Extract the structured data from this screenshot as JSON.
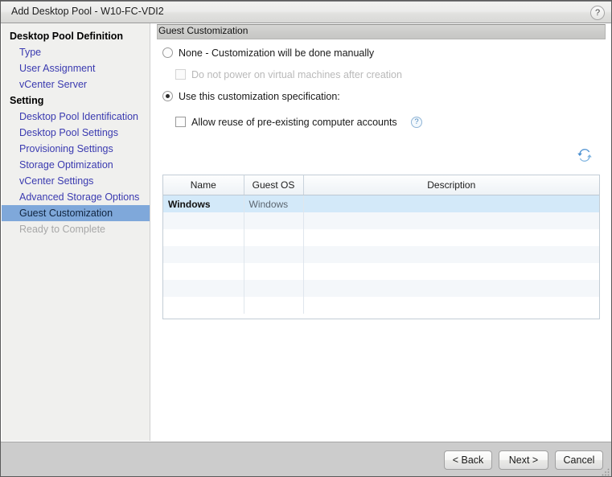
{
  "window": {
    "title": "Add Desktop Pool - W10-FC-VDI2",
    "help_icon": "question-mark-icon",
    "help_label": "?"
  },
  "sidebar": {
    "sections": [
      {
        "heading": "Desktop Pool Definition",
        "items": [
          {
            "label": "Type",
            "state": "link"
          },
          {
            "label": "User Assignment",
            "state": "link"
          },
          {
            "label": "vCenter Server",
            "state": "link"
          }
        ]
      },
      {
        "heading": "Setting",
        "items": [
          {
            "label": "Desktop Pool Identification",
            "state": "link"
          },
          {
            "label": "Desktop Pool Settings",
            "state": "link"
          },
          {
            "label": "Provisioning Settings",
            "state": "link"
          },
          {
            "label": "Storage Optimization",
            "state": "link"
          },
          {
            "label": "vCenter Settings",
            "state": "link"
          },
          {
            "label": "Advanced Storage Options",
            "state": "link"
          },
          {
            "label": "Guest Customization",
            "state": "selected"
          },
          {
            "label": "Ready to Complete",
            "state": "disabled"
          }
        ]
      }
    ]
  },
  "main": {
    "panel_title": "Guest Customization",
    "options": {
      "none_radio": {
        "label": "None - Customization will be done manually",
        "checked": false
      },
      "no_power_on_checkbox": {
        "label": "Do not power on virtual machines after creation",
        "checked": false,
        "enabled": false
      },
      "use_spec_radio": {
        "label": "Use this customization specification:",
        "checked": true
      },
      "allow_reuse_checkbox": {
        "label": "Allow reuse of pre-existing computer accounts",
        "checked": false,
        "enabled": true,
        "help_icon": "question-mark-icon",
        "help_label": "?"
      }
    },
    "refresh_icon": "refresh-icon",
    "table": {
      "columns": [
        "Name",
        "Guest OS",
        "Description"
      ],
      "rows": [
        {
          "name": "Windows",
          "guest_os": "Windows",
          "description": "",
          "selected": true
        },
        {
          "name": "",
          "guest_os": "",
          "description": "",
          "selected": false
        },
        {
          "name": "",
          "guest_os": "",
          "description": "",
          "selected": false
        },
        {
          "name": "",
          "guest_os": "",
          "description": "",
          "selected": false
        },
        {
          "name": "",
          "guest_os": "",
          "description": "",
          "selected": false
        },
        {
          "name": "",
          "guest_os": "",
          "description": "",
          "selected": false
        },
        {
          "name": "",
          "guest_os": "",
          "description": "",
          "selected": false
        }
      ]
    }
  },
  "footer": {
    "back_label": "< Back",
    "next_label": "Next >",
    "cancel_label": "Cancel"
  },
  "colors": {
    "selection_blue": "#7fa8da",
    "row_selected_blue": "#d3e9f9",
    "link_blue": "#3a3ab0",
    "accent_icon_blue": "#4a87bd"
  }
}
